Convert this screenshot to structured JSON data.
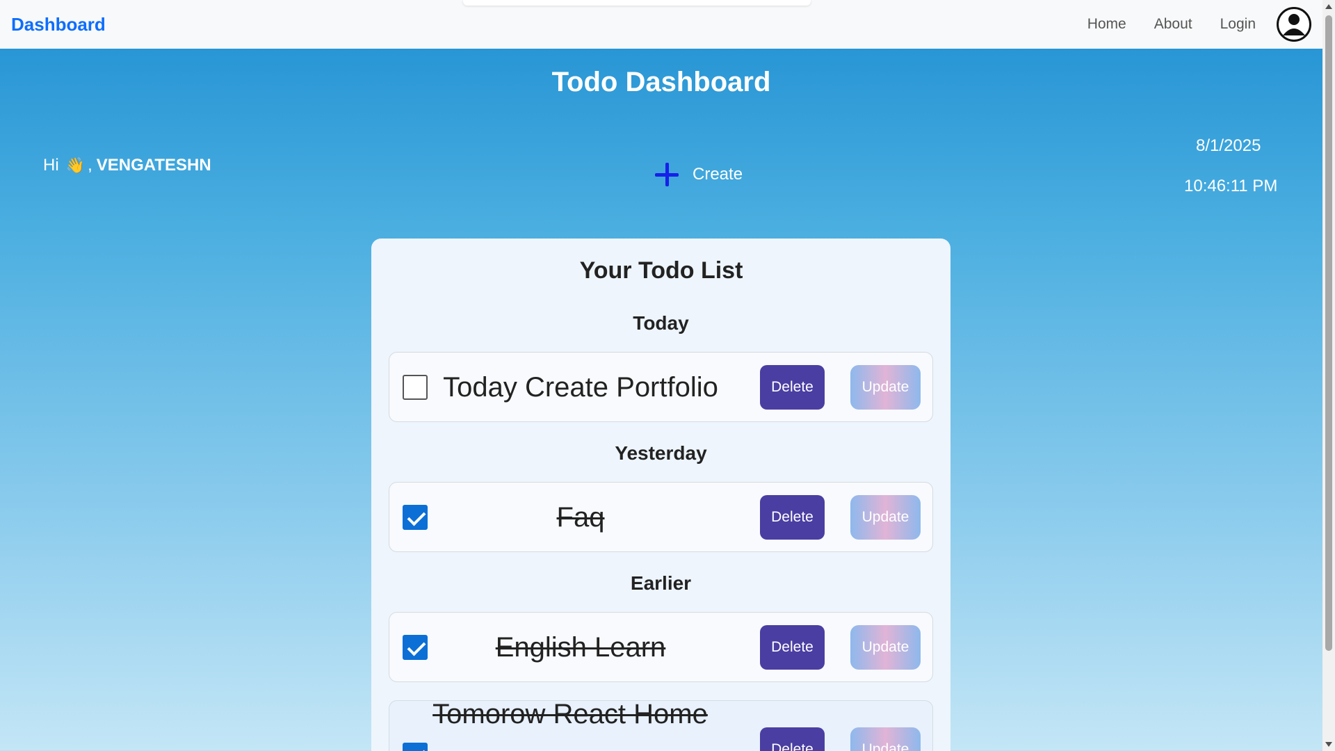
{
  "navbar": {
    "brand": "Dashboard",
    "links": [
      "Home",
      "About",
      "Login"
    ],
    "avatar_icon": "user-circle-icon",
    "brand_color": "#0d6efd"
  },
  "header": {
    "title": "Todo Dashboard",
    "greeting_prefix": "Hi",
    "greeting_emoji": "👋",
    "greeting_comma": ",",
    "username": "VENGATESHN",
    "create_label": "Create",
    "create_icon": "plus-icon",
    "date": "8/1/2025",
    "time": "10:46:11 PM"
  },
  "todo_list": {
    "title": "Your Todo List",
    "sections": [
      {
        "label": "Today",
        "items": [
          {
            "text": "Today Create Portfolio",
            "checked": false,
            "delete_label": "Delete",
            "update_label": "Update"
          }
        ]
      },
      {
        "label": "Yesterday",
        "items": [
          {
            "text": "Faq",
            "checked": true,
            "delete_label": "Delete",
            "update_label": "Update"
          }
        ]
      },
      {
        "label": "Earlier",
        "items": [
          {
            "text": "English Learn",
            "checked": true,
            "delete_label": "Delete",
            "update_label": "Update"
          },
          {
            "text": "Tomorow React Home",
            "checked": true,
            "delete_label": "Delete",
            "update_label": "Update"
          }
        ]
      }
    ]
  },
  "colors": {
    "delete_button": "#4a3ea2",
    "checkbox_checked": "#0b6fd6",
    "create_plus": "#1620e8",
    "background_top": "#1f8fd2",
    "background_bottom": "#c4e6f6"
  }
}
